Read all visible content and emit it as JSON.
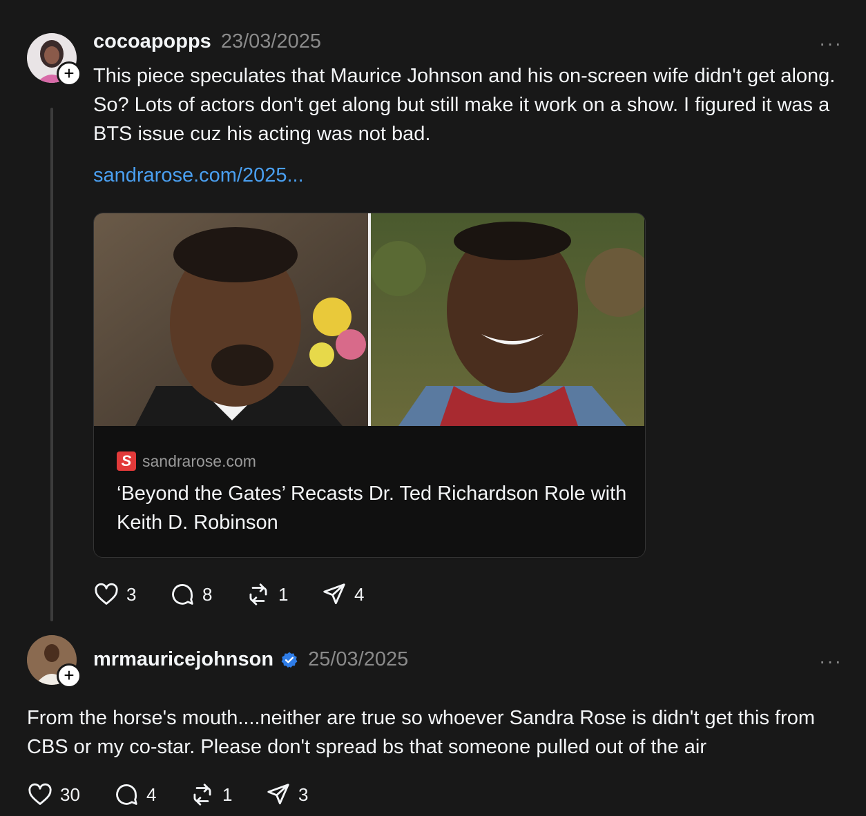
{
  "post1": {
    "username": "cocoapopps",
    "date": "23/03/2025",
    "more_label": "···",
    "text": "This piece speculates that Maurice Johnson and his on-screen wife didn't get along. So? Lots of actors don't get along but still make it work on a show. I figured it was a BTS issue cuz his acting was not bad.",
    "link": "sandrarose.com/2025...",
    "card": {
      "site_icon_letter": "S",
      "site": "sandrarose.com",
      "title": "‘Beyond the Gates’ Recasts Dr. Ted Richardson Role with Keith D. Robinson"
    },
    "actions": {
      "likes": "3",
      "replies": "8",
      "reposts": "1",
      "shares": "4"
    }
  },
  "post2": {
    "username": "mrmauricejohnson",
    "verified": true,
    "date": "25/03/2025",
    "more_label": "···",
    "text": "From the horse's mouth....neither are true so whoever Sandra Rose is didn't get this from CBS or my co-star. Please don't spread bs that someone pulled out of the air",
    "actions": {
      "likes": "30",
      "replies": "4",
      "reposts": "1",
      "shares": "3"
    }
  },
  "icons": {
    "like": "heart-icon",
    "reply": "comment-icon",
    "repost": "repost-icon",
    "share": "send-icon",
    "follow": "plus-icon",
    "verified": "verified-badge-icon"
  },
  "colors": {
    "background": "#181818",
    "link": "#4a9ff0",
    "verified": "#2f7de8",
    "muted": "#8a8a8a"
  }
}
